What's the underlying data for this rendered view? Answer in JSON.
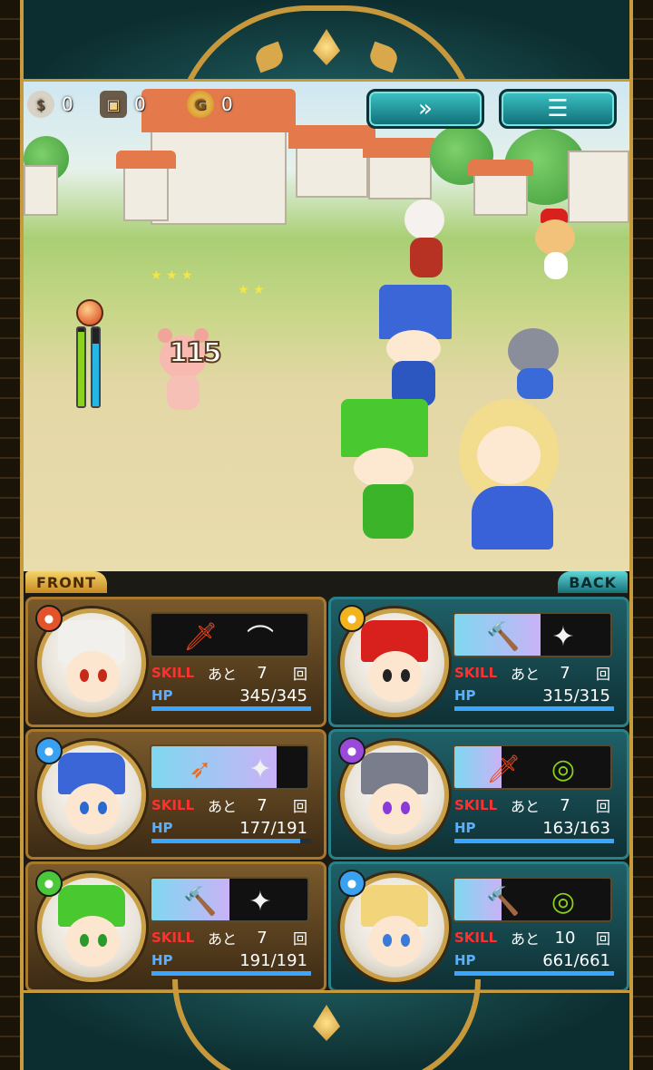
{
  "hud": {
    "bag_count": "0",
    "chest_count": "0",
    "coin_count": "0",
    "fast_forward_icon": "double-chevron-right-icon",
    "menu_icon": "list-menu-icon"
  },
  "battle": {
    "damage_text": "115",
    "gauge_green_fraction": 0.95,
    "gauge_blue_fraction": 0.8
  },
  "party": {
    "front_label": "FRONT",
    "back_label": "BACK",
    "skill_label": "SKILL",
    "hp_label": "HP",
    "remaining_label": "あと",
    "times_label": "回",
    "members": [
      {
        "side": "front",
        "element": "fire",
        "element_color": "#e2542a",
        "name_icon": "white-wolf",
        "weapon1_icon": "sword-icon",
        "weapon2_icon": "bow-icon",
        "skill_fill": 0.0,
        "skill_remaining": "7",
        "hp": "345/345",
        "hp_fraction": 1.0
      },
      {
        "side": "back",
        "element": "light",
        "element_color": "#f2b41e",
        "name_icon": "monkey",
        "weapon1_icon": "hammer-icon",
        "weapon2_icon": "shuriken-icon",
        "skill_fill": 0.55,
        "skill_remaining": "7",
        "hp": "315/315",
        "hp_fraction": 1.0
      },
      {
        "side": "front",
        "element": "water",
        "element_color": "#3aa0f0",
        "name_icon": "blue-soldier",
        "weapon1_icon": "spear-icon",
        "weapon2_icon": "shuriken-icon",
        "skill_fill": 0.8,
        "skill_remaining": "7",
        "hp": "177/191",
        "hp_fraction": 0.93
      },
      {
        "side": "back",
        "element": "dark",
        "element_color": "#9a4ad8",
        "name_icon": "gray-cat-knight",
        "weapon1_icon": "sword-icon",
        "weapon2_icon": "ring-icon",
        "skill_fill": 0.3,
        "skill_remaining": "7",
        "hp": "163/163",
        "hp_fraction": 1.0
      },
      {
        "side": "front",
        "element": "wind",
        "element_color": "#4ac83a",
        "name_icon": "green-soldier",
        "weapon1_icon": "hammer-icon",
        "weapon2_icon": "shuriken-icon",
        "skill_fill": 0.5,
        "skill_remaining": "7",
        "hp": "191/191",
        "hp_fraction": 1.0
      },
      {
        "side": "back",
        "element": "water",
        "element_color": "#3aa0f0",
        "name_icon": "blonde-princess",
        "weapon1_icon": "hammer-icon",
        "weapon2_icon": "ring-icon",
        "skill_fill": 0.3,
        "skill_remaining": "10",
        "hp": "661/661",
        "hp_fraction": 1.0
      }
    ]
  }
}
